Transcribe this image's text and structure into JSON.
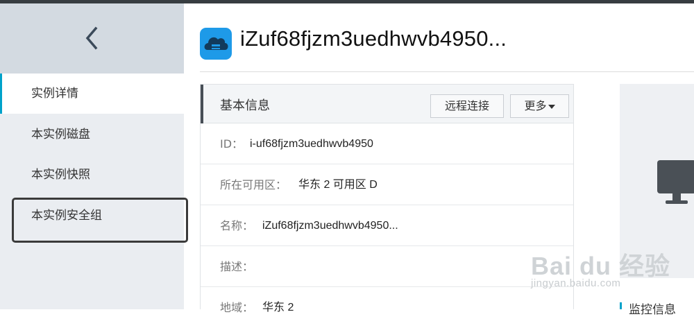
{
  "sidebar": {
    "back_icon": "chevron-left-icon",
    "items": [
      {
        "label": "实例详情",
        "active": true
      },
      {
        "label": "本实例磁盘",
        "active": false
      },
      {
        "label": "本实例快照",
        "active": false
      },
      {
        "label": "本实例安全组",
        "active": false
      }
    ]
  },
  "header": {
    "icon": "cloud-server-icon",
    "title": "iZuf68fjzm3uedhwvb4950..."
  },
  "basic_info": {
    "title": "基本信息",
    "remote_button": "远程连接",
    "more_button": "更多",
    "rows": [
      {
        "label": "ID：",
        "value": "i-uf68fjzm3uedhwvb4950"
      },
      {
        "label": "所在可用区：",
        "value": "华东 2 可用区 D"
      },
      {
        "label": "名称：",
        "value": "iZuf68fjzm3uedhwvb4950..."
      },
      {
        "label": "描述：",
        "value": ""
      },
      {
        "label": "地域：",
        "value": "华东 2"
      }
    ]
  },
  "monitor": {
    "icon": "monitor-icon",
    "label": "监控信息"
  },
  "watermark": {
    "text": "Bai du 经验",
    "url": "jingyan.baidu.com"
  },
  "colors": {
    "accent": "#00a2ca",
    "sidebar_bg": "#eaedf1",
    "back_area_bg": "#d3dae1",
    "header_icon_bg": "#1e9ae8"
  }
}
